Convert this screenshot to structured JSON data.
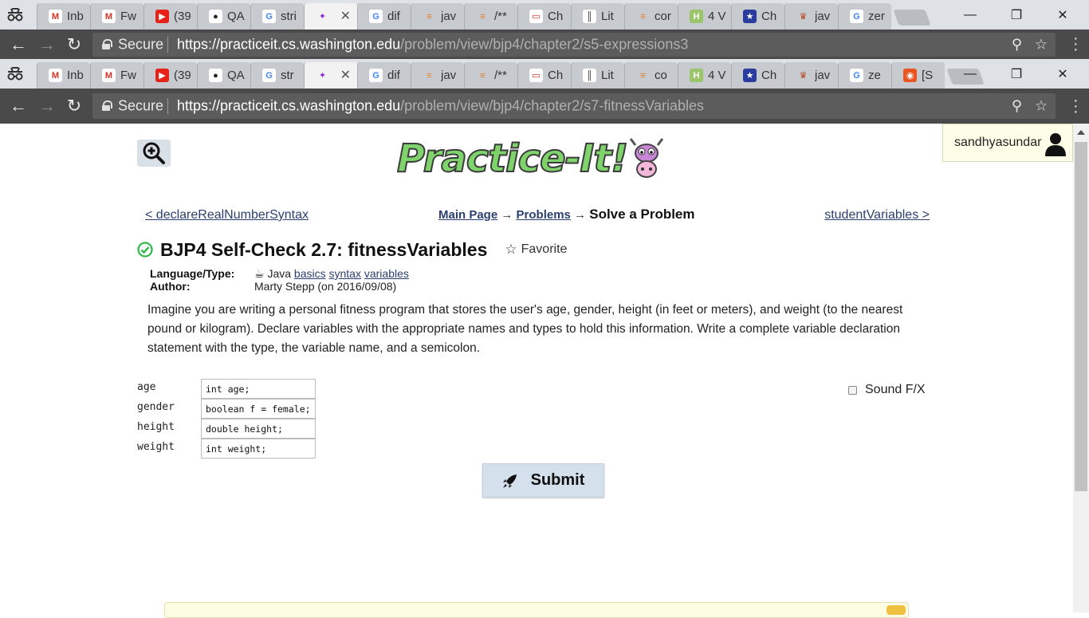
{
  "browser_top": {
    "tabs": [
      {
        "label": "Inb",
        "icon": "gmail-icon"
      },
      {
        "label": "Fw",
        "icon": "gmail-icon"
      },
      {
        "label": "(39",
        "icon": "youtube-icon"
      },
      {
        "label": "QA",
        "icon": "github-icon"
      },
      {
        "label": "stri",
        "icon": "google-icon"
      },
      {
        "label": "",
        "icon": "practiceit-icon",
        "active": true,
        "close": "✕"
      },
      {
        "label": "dif",
        "icon": "google-icon"
      },
      {
        "label": "jav",
        "icon": "stackoverflow-icon"
      },
      {
        "label": "/**",
        "icon": "stackoverflow-icon"
      },
      {
        "label": "Ch",
        "icon": "oracle-icon"
      },
      {
        "label": "Lit",
        "icon": "literal-icon"
      },
      {
        "label": "cor",
        "icon": "stackoverflow-icon"
      },
      {
        "label": "4 V",
        "icon": "wikihow-icon"
      },
      {
        "label": "Ch",
        "icon": "star-icon"
      },
      {
        "label": "jav",
        "icon": "crest-icon"
      },
      {
        "label": "zer",
        "icon": "google-icon"
      }
    ],
    "url_host": "https://practiceit.cs.washington.edu",
    "url_path": "/problem/view/bjp4/chapter2/s5-expressions3",
    "secure_label": "Secure"
  },
  "browser_second": {
    "tabs": [
      {
        "label": "Inb",
        "icon": "gmail-icon"
      },
      {
        "label": "Fw",
        "icon": "gmail-icon"
      },
      {
        "label": "(39",
        "icon": "youtube-icon"
      },
      {
        "label": "QA",
        "icon": "github-icon"
      },
      {
        "label": "str",
        "icon": "google-icon"
      },
      {
        "label": "",
        "icon": "practiceit-icon",
        "active": true,
        "close": "✕"
      },
      {
        "label": "dif",
        "icon": "google-icon"
      },
      {
        "label": "jav",
        "icon": "stackoverflow-icon"
      },
      {
        "label": "/**",
        "icon": "stackoverflow-icon"
      },
      {
        "label": "Ch",
        "icon": "oracle-icon"
      },
      {
        "label": "Lit",
        "icon": "literal-icon"
      },
      {
        "label": "co",
        "icon": "stackoverflow-icon"
      },
      {
        "label": "4 V",
        "icon": "wikihow-icon"
      },
      {
        "label": "Ch",
        "icon": "star-icon"
      },
      {
        "label": "jav",
        "icon": "crest-icon"
      },
      {
        "label": "ze",
        "icon": "google-icon"
      },
      {
        "label": "[S",
        "icon": "ubuntu-icon"
      }
    ],
    "url_host": "https://practiceit.cs.washington.edu",
    "url_path": "/problem/view/bjp4/chapter2/s7-fitnessVariables",
    "secure_label": "Secure"
  },
  "window_controls": {
    "minimize": "—",
    "maximize": "❐",
    "close": "✕"
  },
  "header": {
    "logo_text": "Practice-It!",
    "username": "sandhyasundar"
  },
  "nav": {
    "prev": "< declareRealNumberSyntax",
    "next": "studentVariables >",
    "crumb_main": "Main Page",
    "crumb_problems": "Problems",
    "crumb_current": "Solve a Problem",
    "arrow": "→"
  },
  "problem": {
    "title": "BJP4 Self-Check 2.7: fitnessVariables",
    "favorite": "Favorite",
    "language_label": "Language/Type:",
    "language": "Java",
    "tags": [
      "basics",
      "syntax",
      "variables"
    ],
    "author_label": "Author:",
    "author": "Marty Stepp (on 2016/09/08)",
    "description": "Imagine you are writing a personal fitness program that stores the user's age, gender, height (in feet or meters), and weight (to the nearest pound or kilogram). Declare variables with the appropriate names and types to hold this information. Write a complete variable declaration statement with the type, the variable name, and a semicolon."
  },
  "form": {
    "fields": [
      {
        "label": "age",
        "value": "int age;"
      },
      {
        "label": "gender",
        "value": "boolean f = female;"
      },
      {
        "label": "height",
        "value": "double height;"
      },
      {
        "label": "weight",
        "value": "int weight;"
      }
    ],
    "sound_label": "Sound F/X",
    "submit_label": "Submit"
  },
  "colors": {
    "chrome_dark": "#4a4a4a",
    "tab_bg": "#dee1e6",
    "link": "#2b3f6f",
    "logo_green": "#7fd36b",
    "check_green": "#2fb84a",
    "submit_bg": "#d4e0ec"
  }
}
